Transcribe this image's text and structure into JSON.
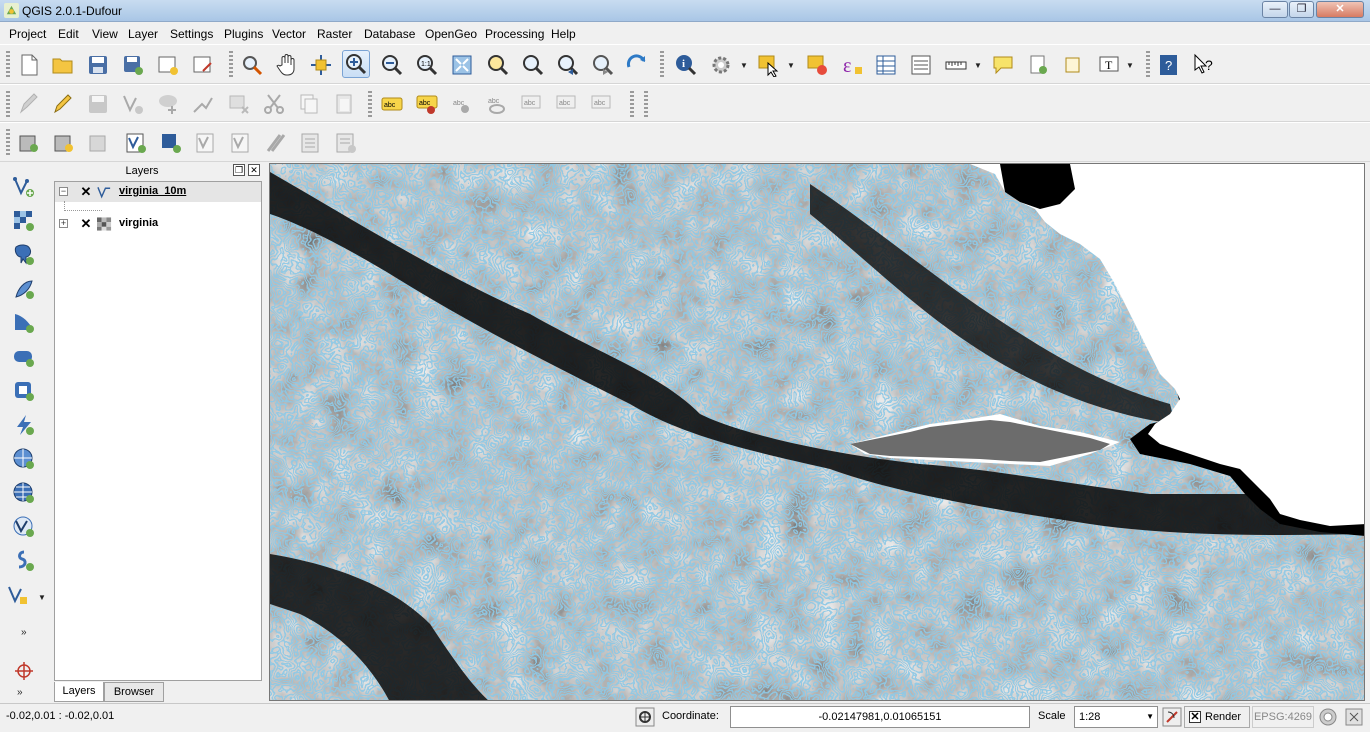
{
  "window": {
    "title": "QGIS 2.0.1-Dufour",
    "minimize": "—",
    "maximize": "❐",
    "close": "✕"
  },
  "menu": [
    "Project",
    "Edit",
    "View",
    "Layer",
    "Settings",
    "Plugins",
    "Vector",
    "Raster",
    "Database",
    "OpenGeo",
    "Processing",
    "Help"
  ],
  "toolbars": {
    "file_tools": [
      "new-project-icon",
      "open-project-icon",
      "save-project-icon",
      "save-as-icon",
      "new-print-composer-icon",
      "composer-manager-icon"
    ],
    "navigation_tools": [
      "touch-zoom-icon",
      "pan-icon",
      "pan-to-selection-icon",
      "zoom-in-icon",
      "zoom-out-icon",
      "zoom-actual-size-icon",
      "zoom-full-icon",
      "zoom-to-selection-icon",
      "zoom-to-layer-icon",
      "zoom-last-icon",
      "zoom-next-icon",
      "refresh-icon"
    ],
    "attribute_tools": [
      "identify-icon",
      "run-action-icon",
      "select-icon",
      "deselect-icon",
      "field-calculator-icon",
      "attribute-table-icon",
      "statistics-icon",
      "measure-icon",
      "map-tips-icon",
      "new-bookmark-icon",
      "show-bookmarks-icon",
      "text-annotation-icon",
      "help-icon",
      "whats-this-icon"
    ],
    "digitizing_tools": [
      "current-edits-icon",
      "toggle-editing-icon",
      "save-edits-icon",
      "add-feature-icon",
      "move-feature-icon",
      "node-tool-icon",
      "delete-selected-icon",
      "cut-features-icon",
      "copy-features-icon",
      "paste-features-icon"
    ],
    "label_tools": [
      "label-icon",
      "pin-labels-icon",
      "show-hide-labels-icon",
      "move-label-icon",
      "rotate-label-icon",
      "change-label-icon",
      "label-settings-icon"
    ],
    "manage_layers": [
      "add-spatialite-icon",
      "add-mssql-icon",
      "add-oracle-icon",
      "new-shapefile-icon",
      "new-spatialite-icon",
      "add-delimited-text-icon",
      "add-vector-icon",
      "add-wfs-icon",
      "add-wcs-icon",
      "add-postgis-icon"
    ]
  },
  "left_toolbar": [
    "add-vector-layer-icon",
    "add-raster-layer-icon",
    "add-postgis-layer-icon",
    "add-spatialite-layer-icon",
    "add-mssql-layer-icon",
    "add-oracle-layer-icon",
    "add-wms-layer-icon",
    "add-wcs-layer-icon",
    "add-wfs-layer-icon",
    "add-delimited-text-icon",
    "add-gps-icon",
    "new-layer-icon",
    "more-tools-icon",
    "crosshair-icon",
    "more-tools-icon-2"
  ],
  "layers_panel": {
    "title": "Layers",
    "layers": [
      {
        "name": "virginia_10m",
        "type": "vector-line",
        "checked": true,
        "expanded": true
      },
      {
        "name": "virginia",
        "type": "raster",
        "checked": true,
        "expanded": false
      }
    ],
    "tabs": [
      "Layers",
      "Browser"
    ],
    "active_tab": "Layers"
  },
  "map": {
    "contour_color": "#8ec9e6",
    "background_color": "#000000"
  },
  "statusbar": {
    "cursor_readout": "-0.02,0.01 : -0.02,0.01",
    "coordinate_label": "Coordinate:",
    "coordinate_value": "-0.02147981,0.01065151",
    "scale_label": "Scale",
    "scale_value": "1:28",
    "render_label": "Render",
    "epsg": "EPSG:4269"
  }
}
